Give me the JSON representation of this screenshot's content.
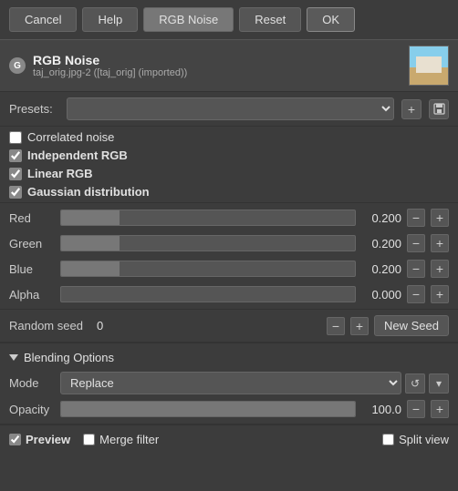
{
  "toolbar": {
    "cancel_label": "Cancel",
    "help_label": "Help",
    "rgb_noise_label": "RGB Noise",
    "reset_label": "Reset",
    "ok_label": "OK"
  },
  "header": {
    "icon_letter": "G",
    "title": "RGB Noise",
    "subtitle": "taj_orig.jpg-2 ([taj_orig] (imported))"
  },
  "presets": {
    "label": "Presets:",
    "value": "",
    "add_btn": "+",
    "save_btn": "💾"
  },
  "options": {
    "correlated_noise": {
      "label": "Correlated noise",
      "checked": false
    },
    "independent_rgb": {
      "label": "Independent RGB",
      "checked": true,
      "bold": true
    },
    "linear_rgb": {
      "label": "Linear RGB",
      "checked": true,
      "bold": true
    },
    "gaussian_distribution": {
      "label": "Gaussian distribution",
      "checked": true,
      "bold": true
    }
  },
  "sliders": [
    {
      "label": "Red",
      "value": "0.200",
      "fill_pct": 20
    },
    {
      "label": "Green",
      "value": "0.200",
      "fill_pct": 20
    },
    {
      "label": "Blue",
      "value": "0.200",
      "fill_pct": 20
    },
    {
      "label": "Alpha",
      "value": "0.000",
      "fill_pct": 0
    }
  ],
  "random_seed": {
    "label": "Random seed",
    "value": "0",
    "new_seed_label": "New Seed"
  },
  "blending": {
    "title": "Blending Options",
    "mode_label": "Mode",
    "mode_value": "Replace",
    "opacity_label": "Opacity",
    "opacity_value": "100.0"
  },
  "footer": {
    "preview_label": "Preview",
    "merge_filter_label": "Merge filter",
    "split_view_label": "Split view"
  }
}
